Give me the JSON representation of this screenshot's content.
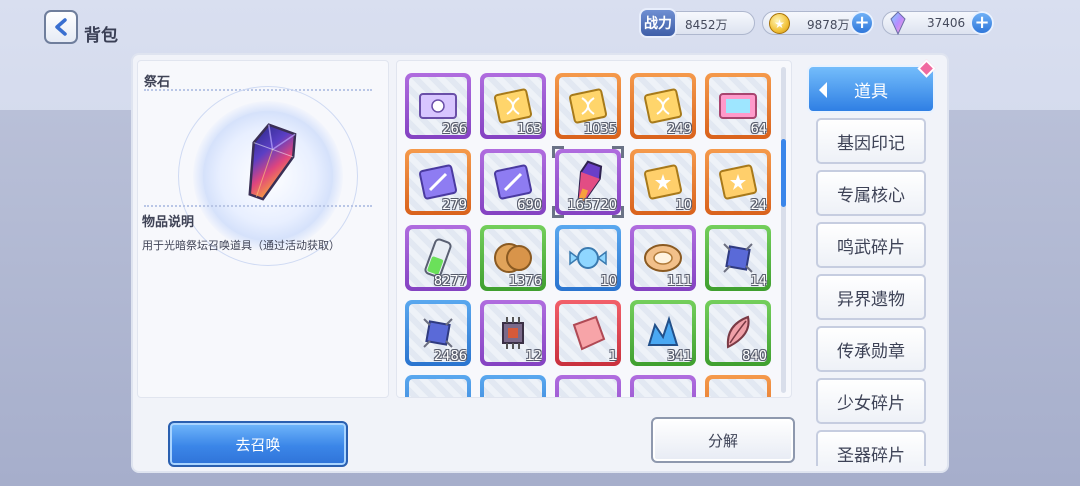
{
  "header": {
    "title": "背包"
  },
  "resources": {
    "power_label": "战力",
    "power_value": "8452万",
    "gold_value": "9878万",
    "gem_value": "37406"
  },
  "detail": {
    "name": "祭石",
    "desc_title": "物品说明",
    "desc_text": "用于光暗祭坛召唤道具（通过活动获取）"
  },
  "items": [
    {
      "icon": "ticket-icon",
      "rarity": "purple",
      "count": "266"
    },
    {
      "icon": "dna-card-icon",
      "rarity": "purple",
      "count": "163"
    },
    {
      "icon": "dna-card-icon",
      "rarity": "orange",
      "count": "1035"
    },
    {
      "icon": "dna-card-icon",
      "rarity": "orange",
      "count": "249"
    },
    {
      "icon": "rainbow-ticket-icon",
      "rarity": "orange",
      "count": "64"
    },
    {
      "icon": "sword-card-icon",
      "rarity": "orange",
      "count": "279"
    },
    {
      "icon": "sword-card-icon",
      "rarity": "purple",
      "count": "690"
    },
    {
      "icon": "sacrifice-stone-icon",
      "rarity": "purple",
      "count": "165720"
    },
    {
      "icon": "star-card-icon",
      "rarity": "orange",
      "count": "10"
    },
    {
      "icon": "star-card-icon",
      "rarity": "orange",
      "count": "24"
    },
    {
      "icon": "battery-icon",
      "rarity": "purple",
      "count": "8277"
    },
    {
      "icon": "cookie-icon",
      "rarity": "green",
      "count": "1376"
    },
    {
      "icon": "candy-icon",
      "rarity": "blue",
      "count": "10"
    },
    {
      "icon": "cake-roll-icon",
      "rarity": "purple",
      "count": "111"
    },
    {
      "icon": "chip-device-icon",
      "rarity": "green",
      "count": "14"
    },
    {
      "icon": "chip-device-icon",
      "rarity": "blue",
      "count": "2486"
    },
    {
      "icon": "microchip-icon",
      "rarity": "purple",
      "count": "12"
    },
    {
      "icon": "fragment-icon",
      "rarity": "red",
      "count": "1"
    },
    {
      "icon": "crystal-pile-icon",
      "rarity": "green",
      "count": "341"
    },
    {
      "icon": "feather-shard-icon",
      "rarity": "green",
      "count": "840"
    },
    {
      "icon": "item-icon",
      "rarity": "blue",
      "count": ""
    },
    {
      "icon": "item-icon",
      "rarity": "blue",
      "count": ""
    },
    {
      "icon": "item-icon",
      "rarity": "purple",
      "count": ""
    },
    {
      "icon": "item-icon",
      "rarity": "purple",
      "count": ""
    },
    {
      "icon": "item-icon",
      "rarity": "orange",
      "count": ""
    }
  ],
  "buttons": {
    "summon": "去召唤",
    "decompose": "分解"
  },
  "tabs": {
    "active": "道具",
    "list": [
      "基因印记",
      "专属核心",
      "鸣武碎片",
      "异界遗物",
      "传承勋章",
      "少女碎片",
      "圣器碎片"
    ]
  },
  "colors": {
    "accent": "#3a86ea",
    "purple": "#9a55d0",
    "orange": "#e8782e",
    "blue": "#3f8ee0",
    "green": "#56b844",
    "red": "#de4350"
  }
}
